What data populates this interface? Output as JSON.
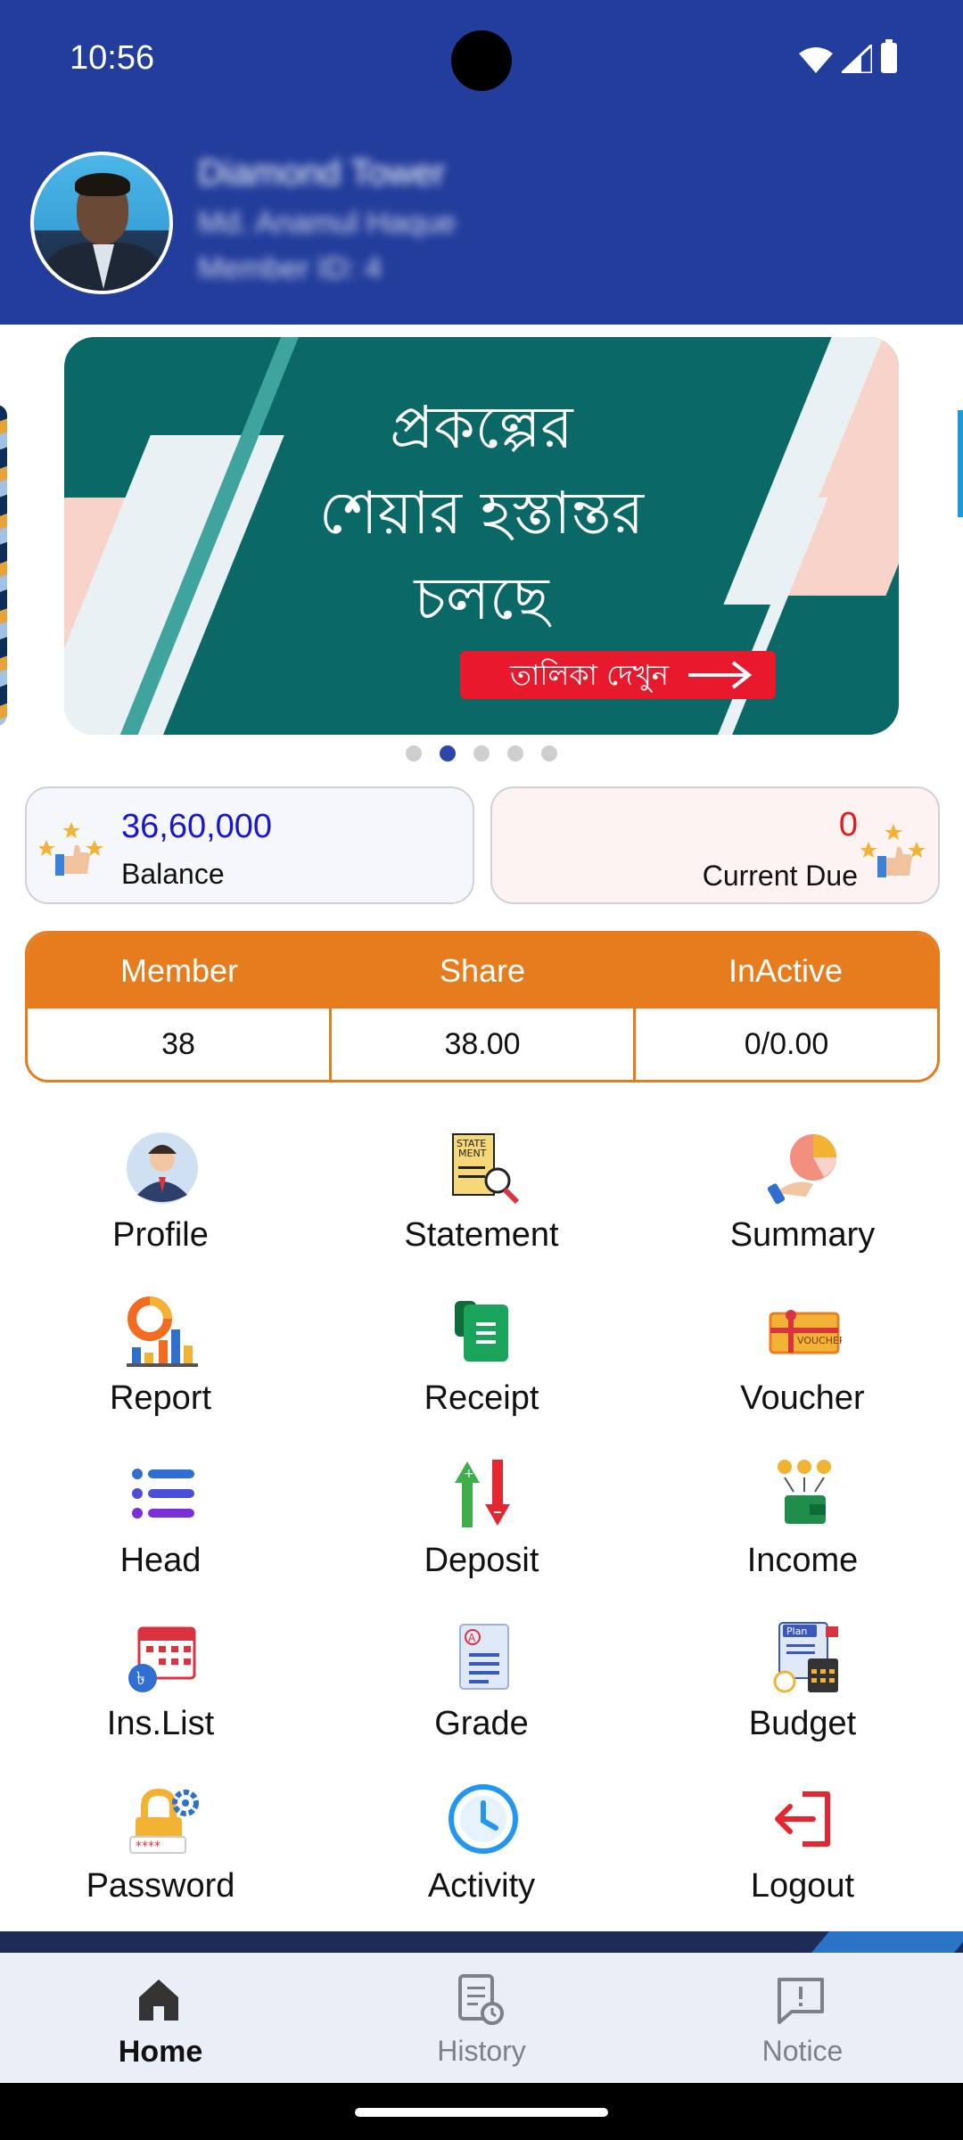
{
  "status_bar": {
    "time": "10:56"
  },
  "header": {
    "title": "Diamond Tower",
    "name": "Md. Anamul Haque",
    "member_id": "Member ID: 4"
  },
  "banner": {
    "lines": [
      "প্রকল্পের",
      "শেয়ার হস্তান্তর",
      "চলছে"
    ],
    "button": "তালিকা দেখুন",
    "dot_count": 5,
    "active_dot": 1
  },
  "balance_card": {
    "value": "36,60,000",
    "label": "Balance"
  },
  "due_card": {
    "value": "0",
    "label": "Current Due"
  },
  "stats": {
    "headers": [
      "Member",
      "Share",
      "InActive"
    ],
    "values": [
      "38",
      "38.00",
      "0/0.00"
    ]
  },
  "menu": [
    {
      "label": "Profile",
      "icon": "profile-icon"
    },
    {
      "label": "Statement",
      "icon": "statement-icon"
    },
    {
      "label": "Summary",
      "icon": "summary-icon"
    },
    {
      "label": "Report",
      "icon": "report-icon"
    },
    {
      "label": "Receipt",
      "icon": "receipt-icon"
    },
    {
      "label": "Voucher",
      "icon": "voucher-icon"
    },
    {
      "label": "Head",
      "icon": "head-icon"
    },
    {
      "label": "Deposit",
      "icon": "deposit-icon"
    },
    {
      "label": "Income",
      "icon": "income-icon"
    },
    {
      "label": "Ins.List",
      "icon": "ins-list-icon"
    },
    {
      "label": "Grade",
      "icon": "grade-icon"
    },
    {
      "label": "Budget",
      "icon": "budget-icon"
    },
    {
      "label": "Password",
      "icon": "password-icon"
    },
    {
      "label": "Activity",
      "icon": "activity-icon"
    },
    {
      "label": "Logout",
      "icon": "logout-icon"
    }
  ],
  "bottom_nav": [
    {
      "label": "Home",
      "icon": "home-icon",
      "active": true
    },
    {
      "label": "History",
      "icon": "history-icon",
      "active": false
    },
    {
      "label": "Notice",
      "icon": "notice-icon",
      "active": false
    }
  ],
  "colors": {
    "header": "#233d9c",
    "accent_orange": "#e77c1e",
    "balance_blue": "#1717d1",
    "due_red": "#e11c1c",
    "banner_bg": "#0a6866"
  }
}
